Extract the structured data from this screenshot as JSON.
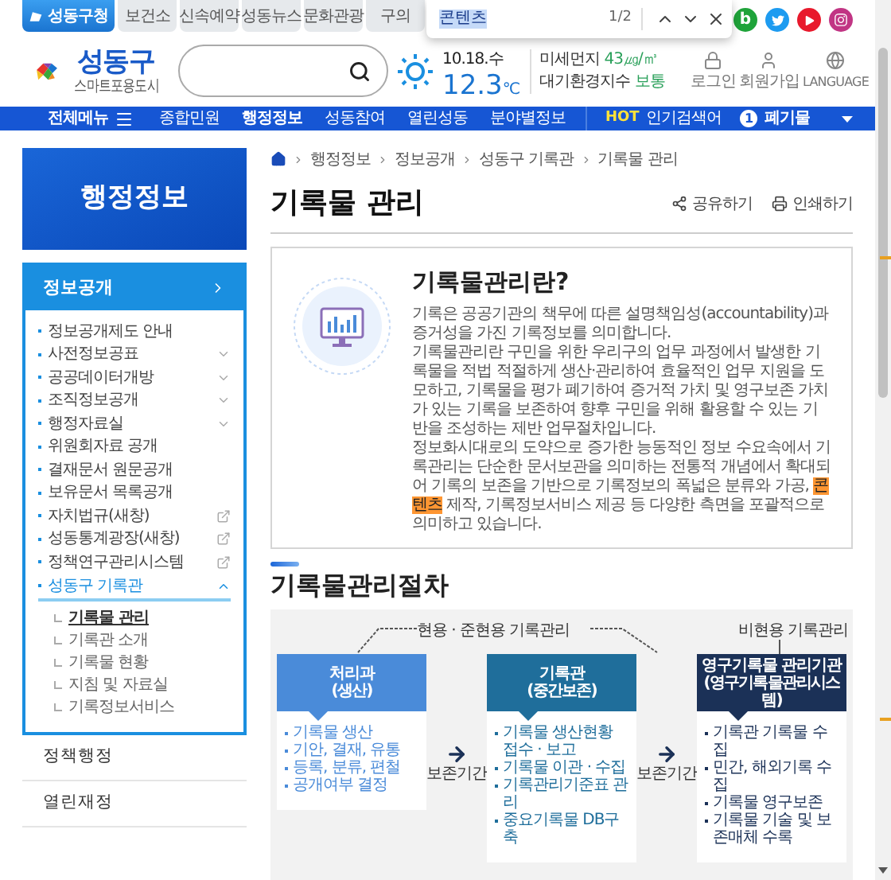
{
  "top_tabs": [
    {
      "label": "성동구청",
      "selected": true
    },
    {
      "label": "보건소",
      "selected": false
    },
    {
      "label": "신속예약",
      "selected": false
    },
    {
      "label": "성동뉴스",
      "selected": false
    },
    {
      "label": "문화관광",
      "selected": false
    },
    {
      "label": "구의",
      "selected": false
    }
  ],
  "find_bar": {
    "query": "콘텐츠",
    "count": "1/2"
  },
  "social_links": [
    {
      "kind": "blog",
      "label": "b"
    },
    {
      "kind": "twitter"
    },
    {
      "kind": "youtube"
    },
    {
      "kind": "instagram"
    }
  ],
  "logo": {
    "name": "성동구",
    "tagline": "스마트포용도시"
  },
  "weather": {
    "date": "10.18.수",
    "temperature": "12.3",
    "unit": "℃"
  },
  "air": [
    {
      "label": "미세먼지",
      "value": "43㎍/㎥"
    },
    {
      "label": "대기환경지수",
      "value": "보통"
    }
  ],
  "user_links": [
    {
      "kind": "login",
      "label": "로그인"
    },
    {
      "kind": "signup",
      "label": "회원가입"
    },
    {
      "kind": "language",
      "label": "LANGUAGE"
    }
  ],
  "nav": {
    "all_menu": "전체메뉴",
    "items": [
      {
        "label": "종합민원",
        "selected": false
      },
      {
        "label": "행정정보",
        "selected": true
      },
      {
        "label": "성동참여",
        "selected": false
      },
      {
        "label": "열린성동",
        "selected": false
      },
      {
        "label": "분야별정보",
        "selected": false
      }
    ],
    "hot": {
      "badge": "HOT",
      "label": "인기검색어",
      "rank": "1",
      "keyword": "폐기물"
    }
  },
  "sidebar": {
    "title": "행정정보",
    "section": {
      "label": "정보공개",
      "expanded": true
    },
    "items": [
      {
        "label": "정보공개제도 안내",
        "kind": "link"
      },
      {
        "label": "사전정보공표",
        "kind": "dropdown",
        "expanded": false
      },
      {
        "label": "공공데이터개방",
        "kind": "dropdown",
        "expanded": false
      },
      {
        "label": "조직정보공개",
        "kind": "dropdown",
        "expanded": false
      },
      {
        "label": "행정자료실",
        "kind": "dropdown",
        "expanded": false
      },
      {
        "label": "위원회자료 공개",
        "kind": "link"
      },
      {
        "label": "결재문서 원문공개",
        "kind": "link"
      },
      {
        "label": "보유문서 목록공개",
        "kind": "link"
      },
      {
        "label": "자치법규(새창)",
        "kind": "external"
      },
      {
        "label": "성동통계광장(새창)",
        "kind": "external"
      },
      {
        "label": "정책연구관리시스템",
        "kind": "external"
      },
      {
        "label": "성동구 기록관",
        "kind": "dropdown",
        "expanded": true,
        "children": [
          {
            "label": "기록물 관리",
            "selected": true
          },
          {
            "label": "기록관 소개",
            "selected": false
          },
          {
            "label": "기록물 현황",
            "selected": false
          },
          {
            "label": "지침 및 자료실",
            "selected": false
          },
          {
            "label": "기록정보서비스",
            "selected": false
          }
        ]
      }
    ],
    "other_sections": [
      "정책행정",
      "열린재정"
    ]
  },
  "breadcrumbs": [
    "행정정보",
    "정보공개",
    "성동구 기록관",
    "기록물 관리"
  ],
  "page_title": "기록물 관리",
  "actions": [
    {
      "kind": "share",
      "label": "공유하기"
    },
    {
      "kind": "print",
      "label": "인쇄하기"
    }
  ],
  "intro": {
    "title": "기록물관리란?",
    "paragraphs": [
      [
        {
          "text": "기록은 공공기관의 책무에 따른 설명책임성(accountability)과 증거성을 가진 기록정보를 의미합니다.",
          "highlighted": false
        }
      ],
      [
        {
          "text": "기록물관리란 구민을 위한 우리구의 업무 과정에서 발생한 기록물을 적법 적절하게 생산·관리하여 효율적인 업무 지원을 도모하고, 기록물을 평가 폐기하여 증거적 가치 및 영구보존 가치가 있는 기록을 보존하여 향후 구민을 위해 활용할 수 있는 기반을 조성하는 제반 업무절차입니다.",
          "highlighted": false
        }
      ],
      [
        {
          "text": "정보화시대로의 도약으로 증가한 능동적인 정보 수요속에서 기록관리는 단순한 문서보관을 의미하는 전통적 개념에서 확대되어 기록의 보존을 기반으로 기록정보의 폭넓은 분류와 가공, ",
          "highlighted": false
        },
        {
          "text": "콘텐츠",
          "highlighted": true
        },
        {
          "text": " 제작, 기록정보서비스 제공 등 다양한 측면을 포괄적으로 의미하고 있습니다.",
          "highlighted": false
        }
      ]
    ]
  },
  "procedure": {
    "title": "기록물관리절차",
    "phases": [
      {
        "label": "현용 · 준현용 기록관리"
      },
      {
        "label": "비현용 기록관리"
      }
    ],
    "stages": [
      {
        "title": "처리과",
        "subtitle": "(생산)",
        "color": "#4a8bd9",
        "tasks": [
          "기록물 생산",
          "기안, 결재, 유통",
          "등록, 분류, 편철",
          "공개여부 결정"
        ]
      },
      {
        "title": "기록관",
        "subtitle": "(중간보존)",
        "color": "#1f6e9b",
        "tasks": [
          "기록물 생산현황 접수 · 보고",
          "기록물 이관 · 수집",
          "기록관리기준표 관리",
          "중요기록물 DB구축"
        ]
      },
      {
        "title": "영구기록물 관리기관",
        "subtitle": "(영구기록물관리시스템)",
        "color": "#1b3157",
        "tasks": [
          "기록관 기록물 수집",
          "민간, 해외기록 수집",
          "기록물 영구보존",
          "기록물 기술 및 보존매체 수록"
        ]
      }
    ],
    "transfers": [
      "보존기간",
      "보존기간"
    ]
  }
}
